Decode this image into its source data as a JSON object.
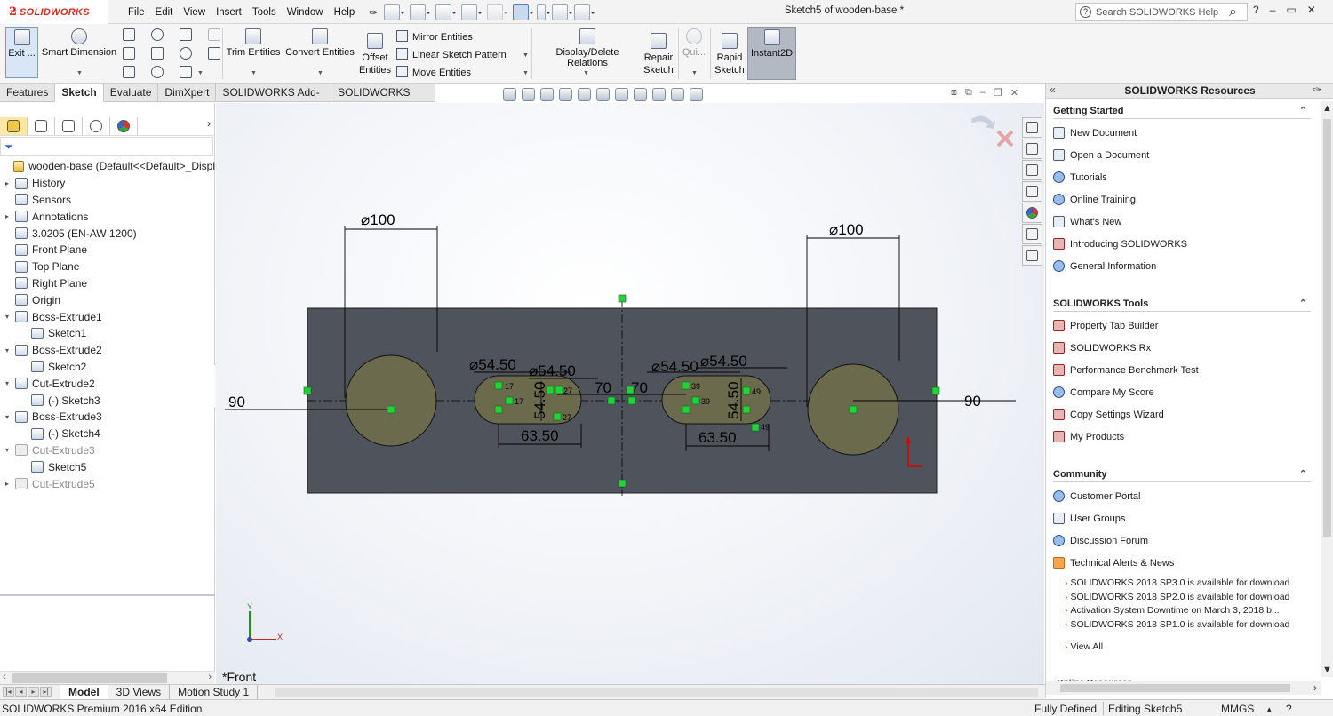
{
  "app": {
    "brand": "SOLIDWORKS",
    "doc_title": "Sketch5 of wooden-base *"
  },
  "menu": [
    "File",
    "Edit",
    "View",
    "Insert",
    "Tools",
    "Window",
    "Help"
  ],
  "search": {
    "placeholder": "Search SOLIDWORKS Help",
    "help": "?"
  },
  "window_controls": [
    "?",
    "–",
    "▭",
    "✕"
  ],
  "ribbon": {
    "exit_sketch": "Exit ...",
    "smart_dimension": "Smart Dimension",
    "trim_entities": "Trim Entities",
    "convert_entities": "Convert Entities",
    "offset_entities": "Offset Entities",
    "mirror_entities": "Mirror Entities",
    "linear_sketch_pattern": "Linear Sketch Pattern",
    "move_entities": "Move Entities",
    "display_delete_relations": "Display/Delete Relations",
    "repair_sketch": "Repair Sketch",
    "quick_snaps": "Qui...",
    "rapid_sketch": "Rapid Sketch",
    "instant2d": "Instant2D"
  },
  "command_tabs": [
    "Features",
    "Sketch",
    "Evaluate",
    "DimXpert",
    "SOLIDWORKS Add-Ins",
    "SOLIDWORKS MBD"
  ],
  "active_command_tab": "Sketch",
  "feature_tree": [
    {
      "label": "wooden-base  (Default<<Default>_Displ",
      "level": 0,
      "icon": "part-icon",
      "toggle": ""
    },
    {
      "label": "History",
      "level": 1,
      "icon": "history-icon",
      "toggle": "▸"
    },
    {
      "label": "Sensors",
      "level": 1,
      "icon": "sensor-icon",
      "toggle": ""
    },
    {
      "label": "Annotations",
      "level": 1,
      "icon": "annotations-icon",
      "toggle": "▸"
    },
    {
      "label": "3.0205 (EN-AW 1200)",
      "level": 1,
      "icon": "material-icon",
      "toggle": ""
    },
    {
      "label": "Front Plane",
      "level": 1,
      "icon": "plane-icon",
      "toggle": ""
    },
    {
      "label": "Top Plane",
      "level": 1,
      "icon": "plane-icon",
      "toggle": ""
    },
    {
      "label": "Right Plane",
      "level": 1,
      "icon": "plane-icon",
      "toggle": ""
    },
    {
      "label": "Origin",
      "level": 1,
      "icon": "origin-icon",
      "toggle": ""
    },
    {
      "label": "Boss-Extrude1",
      "level": 1,
      "icon": "extrude-icon",
      "toggle": "▾"
    },
    {
      "label": "Sketch1",
      "level": 2,
      "icon": "sketch-icon",
      "toggle": ""
    },
    {
      "label": "Boss-Extrude2",
      "level": 1,
      "icon": "extrude-icon",
      "toggle": "▾"
    },
    {
      "label": "Sketch2",
      "level": 2,
      "icon": "sketch-icon",
      "toggle": ""
    },
    {
      "label": "Cut-Extrude2",
      "level": 1,
      "icon": "cut-icon",
      "toggle": "▾"
    },
    {
      "label": "(-) Sketch3",
      "level": 2,
      "icon": "sketch-icon",
      "toggle": ""
    },
    {
      "label": "Boss-Extrude3",
      "level": 1,
      "icon": "extrude-icon",
      "toggle": "▾"
    },
    {
      "label": "(-) Sketch4",
      "level": 2,
      "icon": "sketch-icon",
      "toggle": ""
    },
    {
      "label": "Cut-Extrude3",
      "level": 1,
      "icon": "cut-icon",
      "toggle": "▾",
      "suppressed": true
    },
    {
      "label": "Sketch5",
      "level": 2,
      "icon": "sketch-icon",
      "toggle": ""
    },
    {
      "label": "Cut-Extrude5",
      "level": 1,
      "icon": "cut-icon",
      "toggle": "▸",
      "suppressed": true
    }
  ],
  "sketch": {
    "dims": {
      "d100_left": "⌀100",
      "d100_right": "⌀100",
      "d90_left": "90",
      "d90_right": "90",
      "d5450_a": "⌀54.50",
      "d5450_b": "⌀54.50",
      "d5450_c": "⌀54.50",
      "d5450_d": "⌀54.50",
      "d70_a": "70",
      "d70_b": "70",
      "v5450_a": "54.50",
      "v5450_b": "54.50",
      "d6350_a": "63.50",
      "d6350_b": "63.50"
    },
    "relations": [
      "17",
      "17",
      "27",
      "27",
      "39",
      "39",
      "49",
      "49"
    ]
  },
  "view_label": "*Front",
  "triad": {
    "x": "X",
    "y": "Y"
  },
  "resources": {
    "title": "SOLIDWORKS Resources",
    "sections": [
      {
        "title": "Getting Started",
        "items": [
          {
            "label": "New Document",
            "icon": "new-document-icon"
          },
          {
            "label": "Open a Document",
            "icon": "open-document-icon"
          },
          {
            "label": "Tutorials",
            "icon": "tutorials-icon"
          },
          {
            "label": "Online Training",
            "icon": "training-icon"
          },
          {
            "label": "What's New",
            "icon": "whats-new-icon"
          },
          {
            "label": "Introducing SOLIDWORKS",
            "icon": "introducing-icon"
          },
          {
            "label": "General Information",
            "icon": "info-icon"
          }
        ]
      },
      {
        "title": "SOLIDWORKS Tools",
        "items": [
          {
            "label": "Property Tab Builder",
            "icon": "property-tab-icon"
          },
          {
            "label": "SOLIDWORKS Rx",
            "icon": "rx-icon"
          },
          {
            "label": "Performance Benchmark Test",
            "icon": "benchmark-icon"
          },
          {
            "label": "Compare My Score",
            "icon": "compare-icon"
          },
          {
            "label": "Copy Settings Wizard",
            "icon": "copy-settings-icon"
          },
          {
            "label": "My Products",
            "icon": "products-icon"
          }
        ]
      },
      {
        "title": "Community",
        "items": [
          {
            "label": "Customer Portal",
            "icon": "portal-icon"
          },
          {
            "label": "User Groups",
            "icon": "user-groups-icon"
          },
          {
            "label": "Discussion Forum",
            "icon": "forum-icon"
          },
          {
            "label": "Technical Alerts & News",
            "icon": "rss-icon"
          }
        ]
      }
    ],
    "news": [
      "SOLIDWORKS 2018 SP3.0 is available for download",
      "SOLIDWORKS 2018 SP2.0 is available for download",
      "Activation System Downtime on March 3, 2018 b...",
      "SOLIDWORKS 2018 SP1.0 is available for download"
    ],
    "view_all": "View All",
    "cut_section": "Online Resources"
  },
  "bottom_tabs": [
    "Model",
    "3D Views",
    "Motion Study 1"
  ],
  "active_bottom_tab": "Model",
  "status": {
    "edition": "SOLIDWORKS Premium 2016 x64 Edition",
    "defined": "Fully Defined",
    "editing": "Editing Sketch5",
    "units": "MMGS",
    "menu_arrow": "▴",
    "help": "?"
  }
}
